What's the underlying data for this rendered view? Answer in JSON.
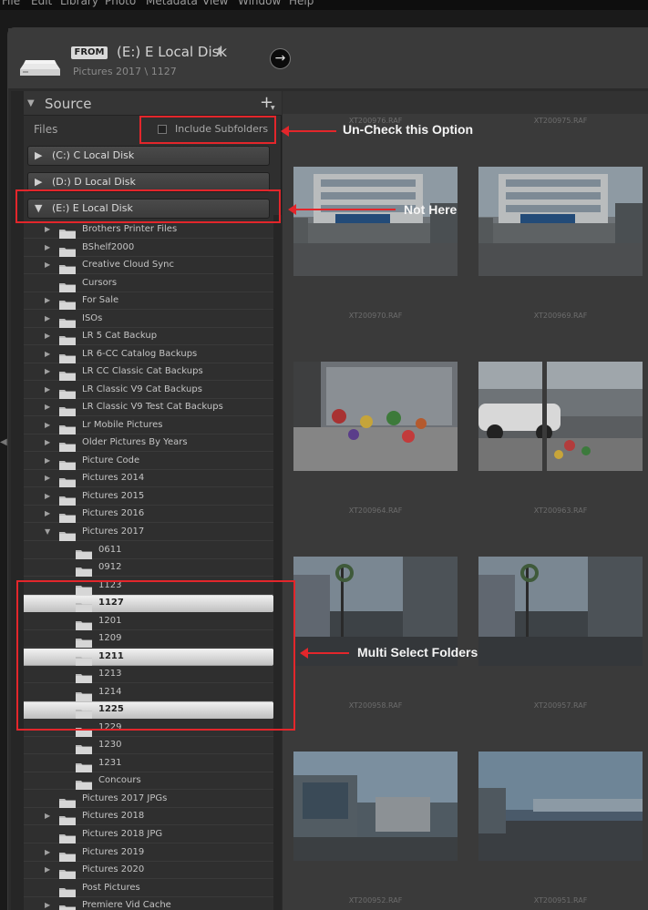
{
  "menu": [
    "File",
    "Edit",
    "Library",
    "Photo",
    "Metadata",
    "View",
    "Window",
    "Help"
  ],
  "header": {
    "from_badge": "FROM",
    "from_title": "(E:) E Local Disk",
    "from_chevron": "⬍",
    "from_path": "Pictures 2017 \\ 1127",
    "go_icon": "→"
  },
  "source": {
    "title": "Source",
    "add_icon": "+",
    "files_label": "Files",
    "include_subfolders_label": "Include Subfolders",
    "include_subfolders_checked": false
  },
  "volumes": [
    {
      "label": "(C:) C Local Disk",
      "expanded": false
    },
    {
      "label": "(D:) D Local Disk",
      "expanded": false
    },
    {
      "label": "(E:) E Local Disk",
      "expanded": true
    }
  ],
  "folders": [
    {
      "label": "Brothers Printer Files",
      "level": 1,
      "has_children": true,
      "selected": false
    },
    {
      "label": "BShelf2000",
      "level": 1,
      "has_children": true,
      "selected": false
    },
    {
      "label": "Creative Cloud Sync",
      "level": 1,
      "has_children": true,
      "selected": false
    },
    {
      "label": "Cursors",
      "level": 1,
      "has_children": false,
      "selected": false
    },
    {
      "label": "For Sale",
      "level": 1,
      "has_children": true,
      "selected": false
    },
    {
      "label": "ISOs",
      "level": 1,
      "has_children": true,
      "selected": false
    },
    {
      "label": "LR 5 Cat Backup",
      "level": 1,
      "has_children": true,
      "selected": false
    },
    {
      "label": "LR 6-CC Catalog Backups",
      "level": 1,
      "has_children": true,
      "selected": false
    },
    {
      "label": "LR CC Classic Cat Backups",
      "level": 1,
      "has_children": true,
      "selected": false
    },
    {
      "label": "LR Classic V9 Cat Backups",
      "level": 1,
      "has_children": true,
      "selected": false
    },
    {
      "label": "LR Classic V9 Test Cat Backups",
      "level": 1,
      "has_children": true,
      "selected": false
    },
    {
      "label": "Lr Mobile Pictures",
      "level": 1,
      "has_children": true,
      "selected": false
    },
    {
      "label": "Older Pictures By Years",
      "level": 1,
      "has_children": true,
      "selected": false
    },
    {
      "label": "Picture Code",
      "level": 1,
      "has_children": true,
      "selected": false
    },
    {
      "label": "Pictures 2014",
      "level": 1,
      "has_children": true,
      "selected": false
    },
    {
      "label": "Pictures 2015",
      "level": 1,
      "has_children": true,
      "selected": false
    },
    {
      "label": "Pictures 2016",
      "level": 1,
      "has_children": true,
      "selected": false
    },
    {
      "label": "Pictures 2017",
      "level": 1,
      "has_children": true,
      "expanded": true,
      "selected": false
    },
    {
      "label": "0611",
      "level": 2,
      "has_children": false,
      "selected": false
    },
    {
      "label": "0912",
      "level": 2,
      "has_children": false,
      "selected": false
    },
    {
      "label": "1123",
      "level": 2,
      "has_children": false,
      "selected": false
    },
    {
      "label": "1127",
      "level": 2,
      "has_children": false,
      "selected": true
    },
    {
      "label": "1201",
      "level": 2,
      "has_children": false,
      "selected": false
    },
    {
      "label": "1209",
      "level": 2,
      "has_children": false,
      "selected": false
    },
    {
      "label": "1211",
      "level": 2,
      "has_children": false,
      "selected": true
    },
    {
      "label": "1213",
      "level": 2,
      "has_children": false,
      "selected": false
    },
    {
      "label": "1214",
      "level": 2,
      "has_children": false,
      "selected": false
    },
    {
      "label": "1225",
      "level": 2,
      "has_children": false,
      "selected": true
    },
    {
      "label": "1229",
      "level": 2,
      "has_children": false,
      "selected": false
    },
    {
      "label": "1230",
      "level": 2,
      "has_children": false,
      "selected": false
    },
    {
      "label": "1231",
      "level": 2,
      "has_children": false,
      "selected": false
    },
    {
      "label": "Concours",
      "level": 2,
      "has_children": false,
      "selected": false
    },
    {
      "label": "Pictures 2017 JPGs",
      "level": 1,
      "has_children": false,
      "selected": false
    },
    {
      "label": "Pictures 2018",
      "level": 1,
      "has_children": true,
      "selected": false
    },
    {
      "label": "Pictures 2018 JPG",
      "level": 1,
      "has_children": false,
      "selected": false
    },
    {
      "label": "Pictures 2019",
      "level": 1,
      "has_children": true,
      "selected": false
    },
    {
      "label": "Pictures 2020",
      "level": 1,
      "has_children": true,
      "selected": false
    },
    {
      "label": "Post Pictures",
      "level": 1,
      "has_children": false,
      "selected": false
    },
    {
      "label": "Premiere Vid Cache",
      "level": 1,
      "has_children": true,
      "selected": false
    }
  ],
  "thumbnails": [
    {
      "top_label": "XT200976.RAF",
      "bottom_label": "XT200970.RAF",
      "scene": "building"
    },
    {
      "top_label": "XT200975.RAF",
      "bottom_label": "XT200969.RAF",
      "scene": "building"
    },
    {
      "top_label": "",
      "bottom_label": "XT200964.RAF",
      "scene": "storefront"
    },
    {
      "top_label": "",
      "bottom_label": "XT200963.RAF",
      "scene": "street-cars"
    },
    {
      "top_label": "",
      "bottom_label": "XT200958.RAF",
      "scene": "wreath-street"
    },
    {
      "top_label": "",
      "bottom_label": "XT200957.RAF",
      "scene": "wreath-street"
    },
    {
      "top_label": "",
      "bottom_label": "XT200952.RAF",
      "scene": "modern-building"
    },
    {
      "top_label": "",
      "bottom_label": "XT200951.RAF",
      "scene": "bridge"
    }
  ],
  "annotations": {
    "uncheck": "Un-Check this Option",
    "not_here": "Not Here",
    "multi_select": "Multi Select Folders"
  },
  "colors": {
    "annotation_red": "#e3262b",
    "selected_row": "#e6e6e6",
    "panel_bg": "#2f2f2f"
  }
}
